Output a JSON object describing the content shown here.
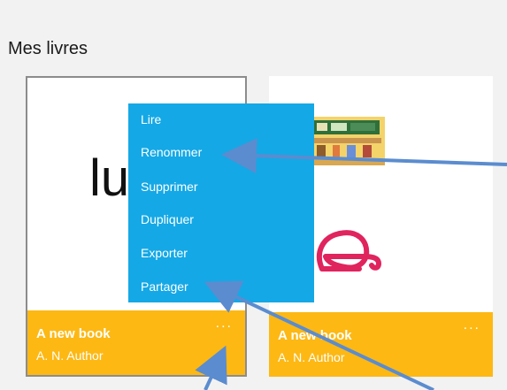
{
  "section": {
    "title": "Mes livres"
  },
  "books": [
    {
      "cover_text": "lu",
      "title": "A new book",
      "author": "A. N. Author",
      "more": "..."
    },
    {
      "title": "A new book",
      "author": "A. N. Author",
      "more": "..."
    }
  ],
  "context_menu": {
    "items": [
      "Lire",
      "Renommer",
      "Supprimer",
      "Dupliquer",
      "Exporter",
      "Partager"
    ]
  },
  "colors": {
    "background": "#f2f2f2",
    "card_footer": "#fdb813",
    "menu": "#14a8e6",
    "annotation_arrow": "#5b8ccf"
  }
}
